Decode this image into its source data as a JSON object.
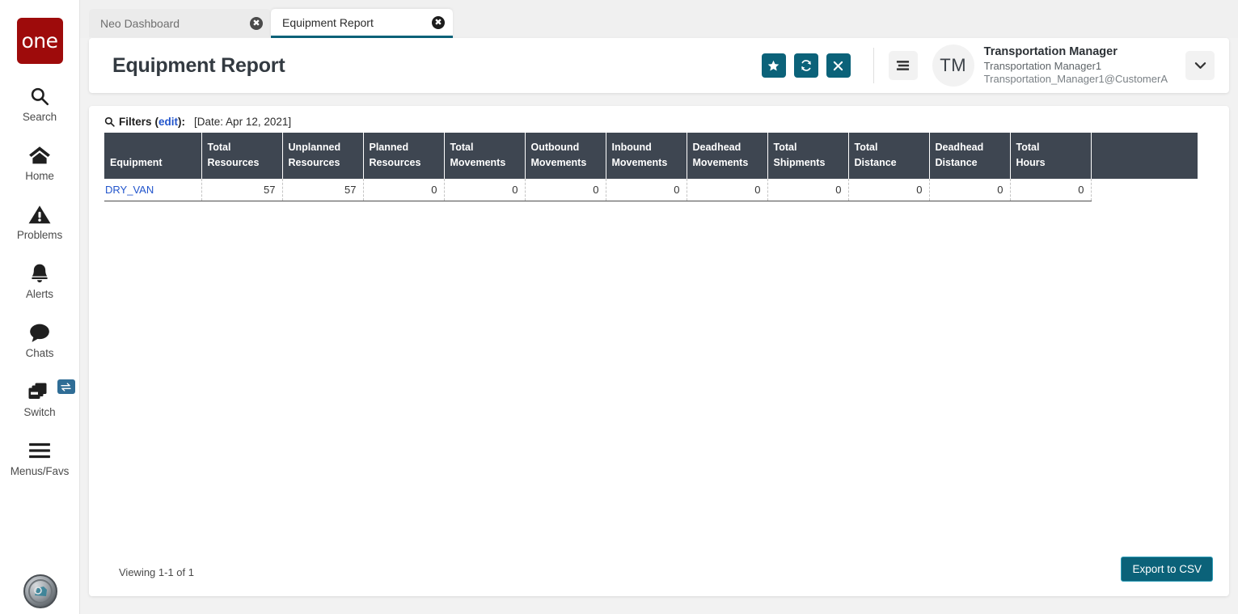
{
  "brand": {
    "logo_text": "one",
    "logo_color": "#9e0b0b"
  },
  "theme": {
    "accent": "#0b6279",
    "table_header_bg": "#3e4651",
    "link": "#2255cc"
  },
  "rail": {
    "items": [
      {
        "icon": "search-icon",
        "label": "Search"
      },
      {
        "icon": "home-icon",
        "label": "Home"
      },
      {
        "icon": "problems-icon",
        "label": "Problems"
      },
      {
        "icon": "alerts-icon",
        "label": "Alerts"
      },
      {
        "icon": "chats-icon",
        "label": "Chats"
      },
      {
        "icon": "switch-icon",
        "label": "Switch"
      },
      {
        "icon": "menus-favs-icon",
        "label": "Menus/Favs"
      }
    ]
  },
  "tabs": [
    {
      "label": "Neo Dashboard",
      "active": false,
      "close": "close-icon"
    },
    {
      "label": "Equipment Report",
      "active": true,
      "close": "close-icon"
    }
  ],
  "header": {
    "title": "Equipment Report",
    "actions": [
      {
        "name": "favorite-button",
        "icon": "star-icon"
      },
      {
        "name": "refresh-button",
        "icon": "refresh-icon"
      },
      {
        "name": "close-button",
        "icon": "x-icon"
      }
    ],
    "menu_icon": "hamburger-icon",
    "caret_icon": "chevron-down-icon",
    "user": {
      "initials": "TM",
      "role": "Transportation Manager",
      "name": "Transportation Manager1",
      "email": "Transportation_Manager1@CustomerA"
    }
  },
  "filters": {
    "icon": "search-icon",
    "label": "Filters",
    "edit_label": "edit",
    "open_paren": "(",
    "close_paren": "):",
    "date_text": "[Date: Apr 12, 2021]"
  },
  "table": {
    "columns": [
      {
        "line1": "Equipment",
        "line2": ""
      },
      {
        "line1": "Total",
        "line2": "Resources"
      },
      {
        "line1": "Unplanned",
        "line2": "Resources"
      },
      {
        "line1": "Planned",
        "line2": "Resources"
      },
      {
        "line1": "Total",
        "line2": "Movements"
      },
      {
        "line1": "Outbound",
        "line2": "Movements"
      },
      {
        "line1": "Inbound",
        "line2": "Movements"
      },
      {
        "line1": "Deadhead",
        "line2": "Movements"
      },
      {
        "line1": "Total",
        "line2": "Shipments"
      },
      {
        "line1": "Total",
        "line2": "Distance"
      },
      {
        "line1": "Deadhead",
        "line2": "Distance"
      },
      {
        "line1": "Total",
        "line2": "Hours"
      },
      {
        "line1": "",
        "line2": ""
      }
    ],
    "rows": [
      {
        "equipment": "DRY_VAN",
        "total_resources": "57",
        "unplanned_resources": "57",
        "planned_resources": "0",
        "total_movements": "0",
        "outbound_movements": "0",
        "inbound_movements": "0",
        "deadhead_movements": "0",
        "total_shipments": "0",
        "total_distance": "0",
        "deadhead_distance": "0",
        "total_hours": "0"
      }
    ]
  },
  "footer": {
    "viewing": "Viewing 1-1 of 1",
    "export_label": "Export to CSV"
  }
}
